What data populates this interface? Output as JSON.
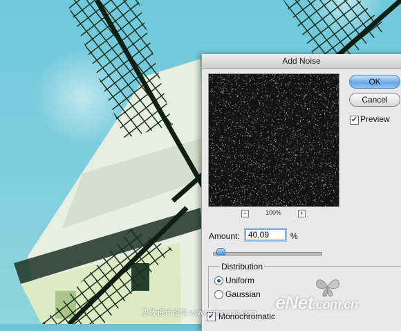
{
  "dialog": {
    "title": "Add Noise",
    "ok_label": "OK",
    "cancel_label": "Cancel",
    "preview_label": "Preview",
    "preview_checked": true,
    "zoom_out_label": "−",
    "zoom_in_label": "+",
    "zoom_level": "100%",
    "amount_label": "Amount:",
    "amount_value": "40,09",
    "amount_unit": "%",
    "amount_slider_fraction": 0.07,
    "distribution": {
      "label": "Distribution",
      "options": [
        "Uniform",
        "Gaussian"
      ],
      "selected": "Uniform"
    },
    "monochromatic_label": "Monochromatic",
    "monochromatic_checked": true
  },
  "watermark": {
    "left_text": "思缘设计论坛  www.missyuan.com",
    "brand_text": "eNet",
    "brand_suffix": ".com.cn"
  },
  "colors": {
    "sky": "#6cc3d8",
    "accent": "#6aa9e6",
    "dialog_bg": "#e9e9e9"
  }
}
